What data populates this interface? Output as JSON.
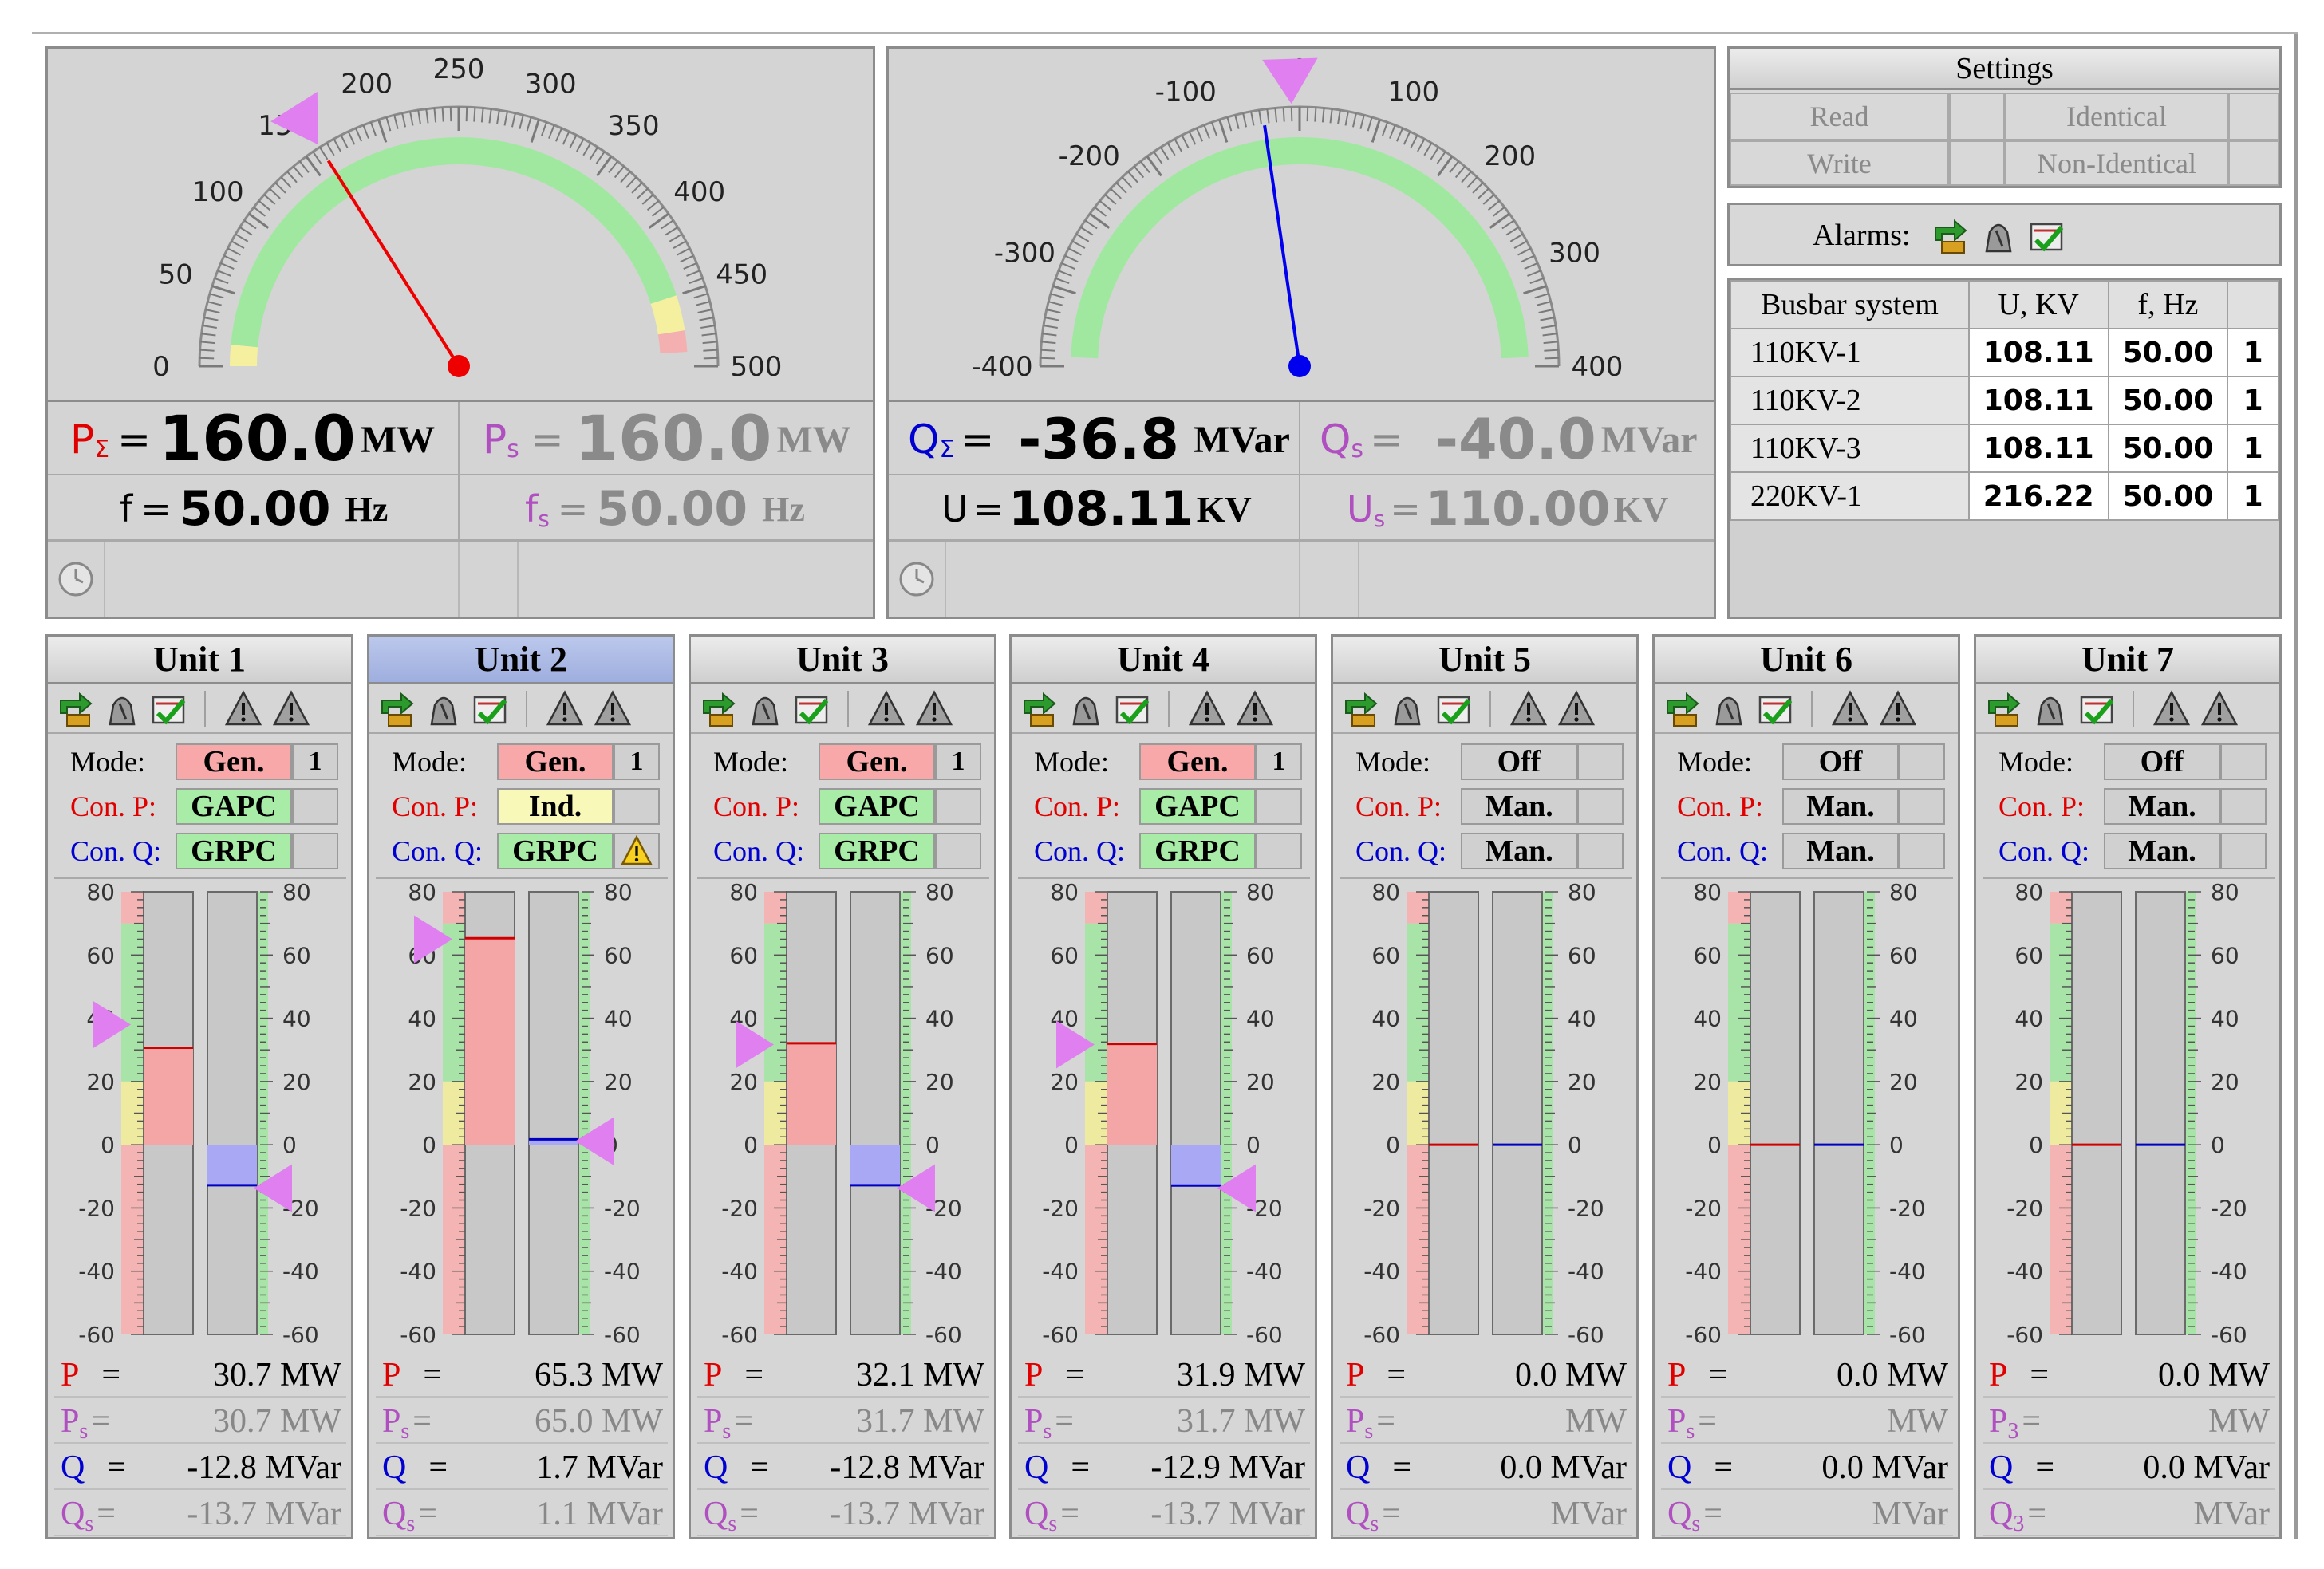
{
  "gauge_p": {
    "ticks": [
      "0",
      "50",
      "100",
      "150",
      "200",
      "250",
      "300",
      "350",
      "400",
      "450",
      "500"
    ],
    "value": 160,
    "setpoint": 160,
    "label_p": "P",
    "label_p_sub": "Σ",
    "p_value": "160.0",
    "p_unit": "MW",
    "label_ps": "P",
    "label_ps_sub": "s",
    "ps_value": "160.0",
    "ps_unit": "MW",
    "label_f": "f",
    "f_value": "50.00",
    "f_unit": "Hz",
    "label_fs": "f",
    "label_fs_sub": "s",
    "fs_value": "50.00",
    "fs_unit": "Hz",
    "eq": "="
  },
  "gauge_q": {
    "ticks": [
      "-400",
      "-300",
      "-200",
      "-100",
      "0",
      "100",
      "200",
      "300",
      "400"
    ],
    "value": -36.8,
    "setpoint": -8,
    "label_q": "Q",
    "label_q_sub": "Σ",
    "q_value": "-36.8",
    "q_unit": "MVar",
    "label_qs": "Q",
    "label_qs_sub": "s",
    "qs_value": "-40.0",
    "qs_unit": "MVar",
    "label_u": "U",
    "u_value": "108.11",
    "u_unit": "KV",
    "label_us": "U",
    "label_us_sub": "s",
    "us_value": "110.00",
    "us_unit": "KV",
    "eq": "="
  },
  "settings": {
    "title": "Settings",
    "read": "Read",
    "identical": "Identical",
    "write": "Write",
    "non_identical": "Non-Identical",
    "alarms_label": "Alarms:"
  },
  "busbar": {
    "headers": [
      "Busbar system",
      "U, KV",
      "f, Hz",
      ""
    ],
    "rows": [
      {
        "name": "110KV-1",
        "u": "108.11",
        "f": "50.00",
        "n": "1"
      },
      {
        "name": "110KV-2",
        "u": "108.11",
        "f": "50.00",
        "n": "1"
      },
      {
        "name": "110KV-3",
        "u": "108.11",
        "f": "50.00",
        "n": "1"
      },
      {
        "name": "220KV-1",
        "u": "216.22",
        "f": "50.00",
        "n": "1"
      }
    ]
  },
  "unit_labels": {
    "mode": "Mode:",
    "conp": "Con. P:",
    "conq": "Con. Q:"
  },
  "bar_ticks": [
    "80",
    "60",
    "40",
    "20",
    "0",
    "-20",
    "-40",
    "-60"
  ],
  "units": [
    {
      "title": "Unit 1",
      "mode": "Gen.",
      "mode_n": "1",
      "conp": "GAPC",
      "conq": "GRPC",
      "warn": false,
      "selected": false,
      "p": 30.7,
      "ps": 38,
      "q": -12.8,
      "qs": -13.7,
      "p_txt": "30.7 MW",
      "ps_txt": "30.7 MW",
      "q_txt": "-12.8 MVar",
      "qs_txt": "-13.7 MVar",
      "ps_sym": "s",
      "qs_sym": "s"
    },
    {
      "title": "Unit 2",
      "mode": "Gen.",
      "mode_n": "1",
      "conp": "Ind.",
      "conq": "GRPC",
      "warn": true,
      "selected": true,
      "p": 65.3,
      "ps": 65,
      "q": 1.7,
      "qs": 1.1,
      "p_txt": "65.3 MW",
      "ps_txt": "65.0 MW",
      "q_txt": "1.7 MVar",
      "qs_txt": "1.1 MVar",
      "ps_sym": "s",
      "qs_sym": "s"
    },
    {
      "title": "Unit 3",
      "mode": "Gen.",
      "mode_n": "1",
      "conp": "GAPC",
      "conq": "GRPC",
      "warn": false,
      "selected": false,
      "p": 32.1,
      "ps": 31.7,
      "q": -12.8,
      "qs": -13.7,
      "p_txt": "32.1 MW",
      "ps_txt": "31.7 MW",
      "q_txt": "-12.8 MVar",
      "qs_txt": "-13.7 MVar",
      "ps_sym": "s",
      "qs_sym": "s"
    },
    {
      "title": "Unit 4",
      "mode": "Gen.",
      "mode_n": "1",
      "conp": "GAPC",
      "conq": "GRPC",
      "warn": false,
      "selected": false,
      "p": 31.9,
      "ps": 31.7,
      "q": -12.9,
      "qs": -13.7,
      "p_txt": "31.9 MW",
      "ps_txt": "31.7 MW",
      "q_txt": "-12.9 MVar",
      "qs_txt": "-13.7 MVar",
      "ps_sym": "s",
      "qs_sym": "s"
    },
    {
      "title": "Unit 5",
      "mode": "Off",
      "mode_n": "",
      "conp": "Man.",
      "conq": "Man.",
      "warn": false,
      "selected": false,
      "p": 0,
      "ps": null,
      "q": 0,
      "qs": null,
      "p_txt": "0.0 MW",
      "ps_txt": "MW",
      "q_txt": "0.0 MVar",
      "qs_txt": "MVar",
      "ps_sym": "s",
      "qs_sym": "s"
    },
    {
      "title": "Unit 6",
      "mode": "Off",
      "mode_n": "",
      "conp": "Man.",
      "conq": "Man.",
      "warn": false,
      "selected": false,
      "p": 0,
      "ps": null,
      "q": 0,
      "qs": null,
      "p_txt": "0.0 MW",
      "ps_txt": "MW",
      "q_txt": "0.0 MVar",
      "qs_txt": "MVar",
      "ps_sym": "s",
      "qs_sym": "s"
    },
    {
      "title": "Unit 7",
      "mode": "Off",
      "mode_n": "",
      "conp": "Man.",
      "conq": "Man.",
      "warn": false,
      "selected": false,
      "p": 0,
      "ps": null,
      "q": 0,
      "qs": null,
      "p_txt": "0.0 MW",
      "ps_txt": "MW",
      "q_txt": "0.0 MVar",
      "qs_txt": "MVar",
      "ps_sym": "3",
      "qs_sym": "3"
    }
  ],
  "colors": {
    "gen": "#f8a8a8",
    "off": "#d0d0d0",
    "auto": "#a8eca8",
    "ind": "#f8f8b8",
    "p_bar": "#f4a6a6",
    "q_bar": "#a8a8f4",
    "setpoint": "#e080f0",
    "red_label": "#e00000",
    "blue_label": "#0000d0",
    "purple_label": "#b050c0"
  }
}
